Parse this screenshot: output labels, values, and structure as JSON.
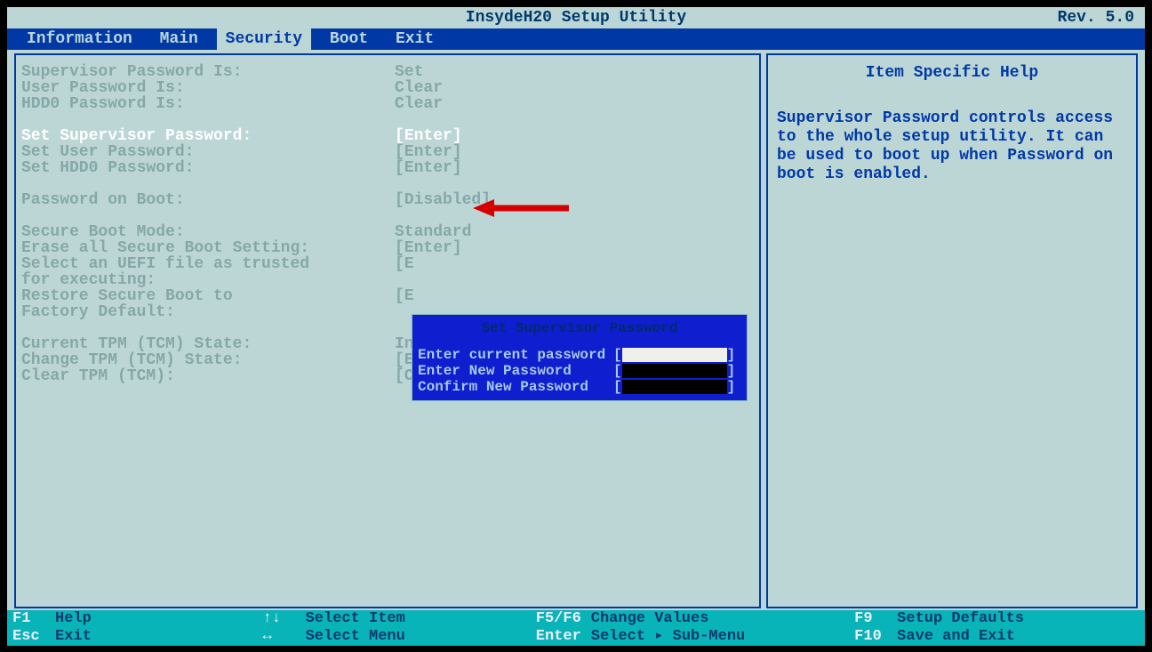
{
  "title": {
    "center": "InsydeH20 Setup Utility",
    "rev": "Rev. 5.0"
  },
  "menu": {
    "items": [
      "Information",
      "Main",
      "Security",
      "Boot",
      "Exit"
    ],
    "active": 2
  },
  "security": {
    "supPwdIs": {
      "label": "Supervisor Password Is:",
      "value": "Set"
    },
    "userPwdIs": {
      "label": "User Password Is:",
      "value": "Clear"
    },
    "hdd0PwdIs": {
      "label": "HDD0 Password Is:",
      "value": "Clear"
    },
    "setSup": {
      "label": "Set Supervisor Password:",
      "value": "[Enter]"
    },
    "setUser": {
      "label": "Set User Password:",
      "value": "[Enter]"
    },
    "setHdd": {
      "label": "Set HDD0 Password:",
      "value": "[Enter]"
    },
    "pwdBoot": {
      "label": "Password on Boot:",
      "value": "[Disabled]"
    },
    "sbMode": {
      "label": "Secure Boot Mode:",
      "value": "Standard"
    },
    "eraseSb": {
      "label": "Erase all Secure Boot Setting:",
      "value": "[Enter]"
    },
    "selUefi1": {
      "label": "Select an UEFI file as trusted",
      "value": "[E"
    },
    "selUefi2": {
      "label": "for executing:",
      "value": ""
    },
    "restoreSb1": {
      "label": "Restore Secure Boot to",
      "value": "[E"
    },
    "restoreSb2": {
      "label": "Factory Default:",
      "value": ""
    },
    "tpmState": {
      "label": "Current TPM (TCM) State:",
      "value": "In"
    },
    "tpmChange": {
      "label": "Change TPM (TCM) State:",
      "value": "[E"
    },
    "tpmClear": {
      "label": "Clear TPM (TCM):",
      "value": "[Clear]"
    }
  },
  "help": {
    "title": "Item Specific Help",
    "text": "Supervisor Password controls access to the whole setup utility. It can be used to boot up when Password on boot is enabled."
  },
  "dialog": {
    "title": "Set Supervisor Password",
    "row1": "Enter current password",
    "row2": "Enter New Password",
    "row3": "Confirm New Password",
    "bl": "[",
    "br": "]"
  },
  "footer": {
    "f1": {
      "k": "F1",
      "t": "Help"
    },
    "esc": {
      "k": "Esc",
      "t": "Exit"
    },
    "ud": {
      "k": "↑↓",
      "t": "Select Item"
    },
    "lr": {
      "k": "↔",
      "t": "Select Menu"
    },
    "f56": {
      "k": "F5/F6",
      "t": "Change Values"
    },
    "ent": {
      "k": "Enter",
      "t": "Select ▸ Sub-Menu"
    },
    "f9": {
      "k": "F9",
      "t": "Setup Defaults"
    },
    "f10": {
      "k": "F10",
      "t": "Save and Exit"
    }
  }
}
